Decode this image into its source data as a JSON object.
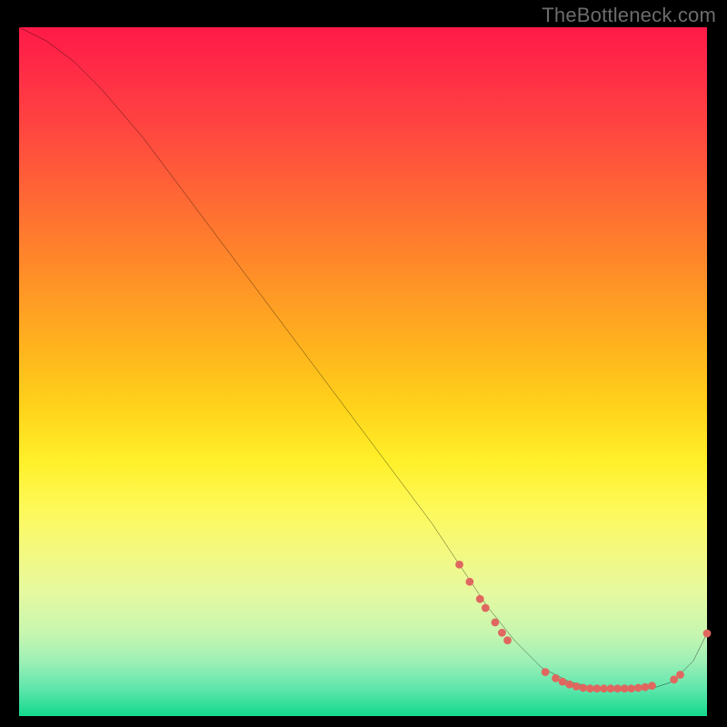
{
  "attribution": "TheBottleneck.com",
  "chart_data": {
    "type": "line",
    "title": "",
    "xlabel": "",
    "ylabel": "",
    "xlim": [
      0,
      100
    ],
    "ylim": [
      0,
      100
    ],
    "grid": false,
    "background": "rainbow-vertical-gradient",
    "curve_color": "#000000",
    "marker_color": "#e0675f",
    "series": [
      {
        "name": "bottleneck-curve",
        "x": [
          0,
          4,
          8,
          12,
          18,
          24,
          30,
          36,
          42,
          48,
          54,
          60,
          64,
          68,
          72,
          76,
          80,
          84,
          88,
          92,
          95,
          98,
          100
        ],
        "y": [
          100,
          98,
          95,
          91,
          84,
          76,
          68,
          60,
          52,
          44,
          36,
          28,
          22,
          16,
          11,
          7,
          5,
          4,
          4,
          4,
          5,
          8,
          12
        ]
      }
    ],
    "markers": [
      {
        "x": 64.0,
        "y": 22.0
      },
      {
        "x": 65.5,
        "y": 19.5
      },
      {
        "x": 67.0,
        "y": 17.0
      },
      {
        "x": 67.8,
        "y": 15.7
      },
      {
        "x": 69.2,
        "y": 13.6
      },
      {
        "x": 70.2,
        "y": 12.1
      },
      {
        "x": 71.0,
        "y": 11.0
      },
      {
        "x": 76.5,
        "y": 6.4
      },
      {
        "x": 78.0,
        "y": 5.5
      },
      {
        "x": 79.0,
        "y": 5.0
      },
      {
        "x": 80.0,
        "y": 4.6
      },
      {
        "x": 81.0,
        "y": 4.3
      },
      {
        "x": 82.0,
        "y": 4.1
      },
      {
        "x": 83.0,
        "y": 4.0
      },
      {
        "x": 84.0,
        "y": 4.0
      },
      {
        "x": 85.0,
        "y": 4.0
      },
      {
        "x": 86.0,
        "y": 4.0
      },
      {
        "x": 87.0,
        "y": 4.0
      },
      {
        "x": 88.0,
        "y": 4.0
      },
      {
        "x": 89.0,
        "y": 4.0
      },
      {
        "x": 90.0,
        "y": 4.1
      },
      {
        "x": 91.0,
        "y": 4.2
      },
      {
        "x": 92.0,
        "y": 4.4
      },
      {
        "x": 95.2,
        "y": 5.3
      },
      {
        "x": 96.1,
        "y": 6.0
      },
      {
        "x": 100.0,
        "y": 12.0
      }
    ]
  }
}
